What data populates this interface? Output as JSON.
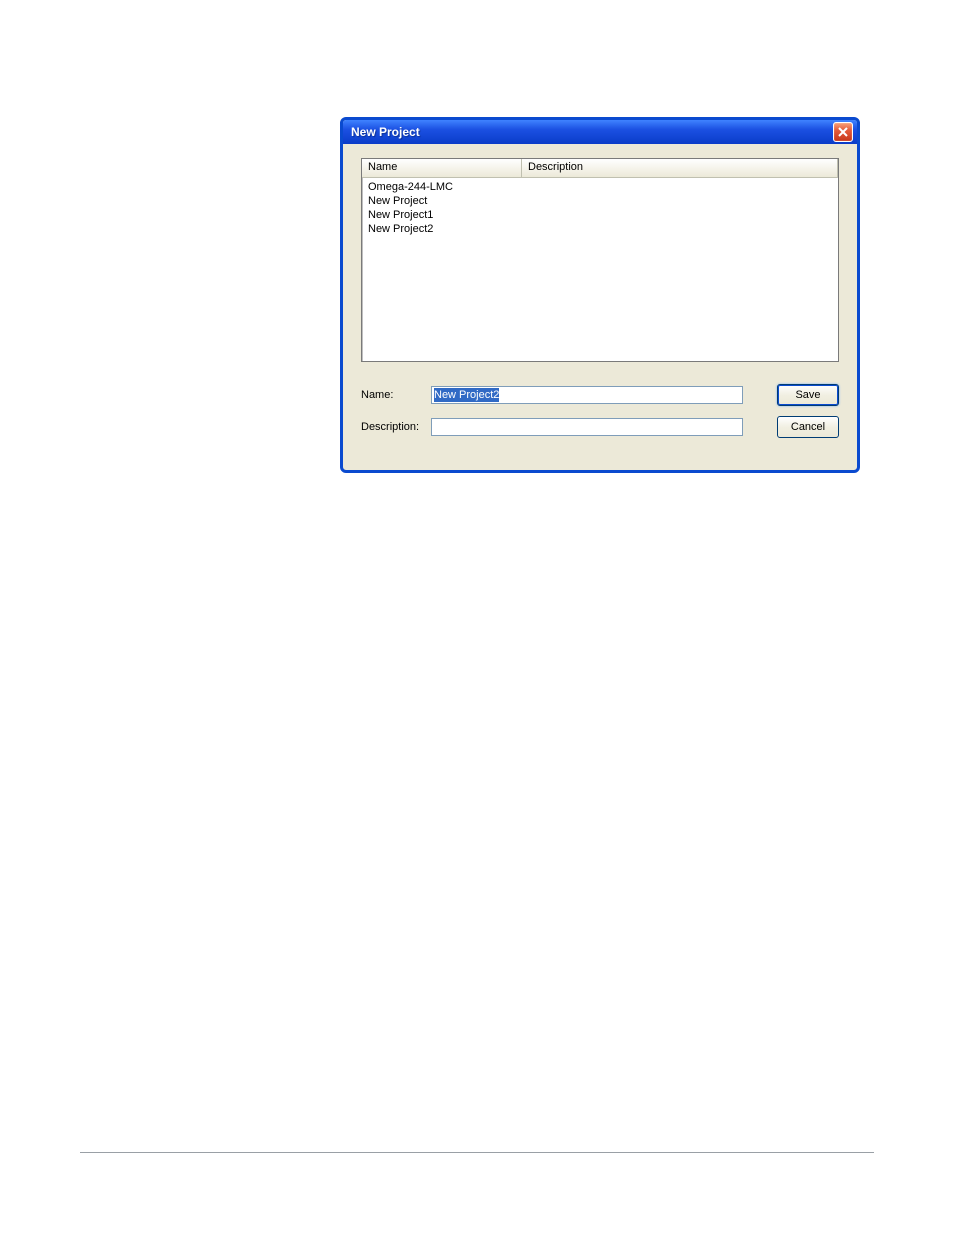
{
  "dialog": {
    "title": "New Project",
    "close_icon": "close-icon"
  },
  "list": {
    "columns": {
      "name": "Name",
      "description": "Description"
    },
    "rows": [
      {
        "name": "Omega-244-LMC",
        "description": ""
      },
      {
        "name": "New Project",
        "description": ""
      },
      {
        "name": "New Project1",
        "description": ""
      },
      {
        "name": "New Project2",
        "description": ""
      }
    ]
  },
  "form": {
    "name_label": "Name:",
    "description_label": "Description:",
    "name_value": "New Project2",
    "description_value": ""
  },
  "buttons": {
    "save": "Save",
    "cancel": "Cancel"
  }
}
